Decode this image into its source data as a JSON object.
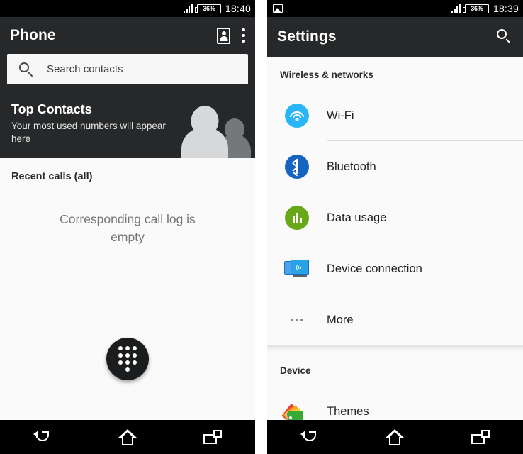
{
  "phone": {
    "statusbar": {
      "signal_icon": "signal-bars-icon",
      "battery_text": "36%",
      "battery_icon": "battery-icon",
      "time": "18:40"
    },
    "appbar": {
      "title": "Phone",
      "contacts_icon": "contacts-card-icon",
      "overflow_icon": "overflow-menu-icon"
    },
    "search": {
      "icon": "search-icon",
      "placeholder": "Search contacts",
      "value": ""
    },
    "top_contacts": {
      "title": "Top Contacts",
      "subtitle": "Your most used numbers will appear here",
      "illustration": "people-silhouette-icon"
    },
    "recent": {
      "label": "Recent calls (all)",
      "empty_message": "Corresponding call log is empty"
    },
    "fab": {
      "icon": "dialpad-icon"
    },
    "navbar": {
      "back": "back-icon",
      "home": "home-icon",
      "recents": "recents-icon"
    }
  },
  "settings": {
    "statusbar": {
      "image_icon": "screenshot-image-icon",
      "signal_icon": "signal-bars-icon",
      "battery_text": "36%",
      "battery_icon": "battery-icon",
      "time": "18:39"
    },
    "appbar": {
      "title": "Settings",
      "search_icon": "search-icon"
    },
    "sections": [
      {
        "heading": "Wireless & networks",
        "items": [
          {
            "label": "Wi-Fi",
            "icon": "wifi-icon",
            "color": "#29b6f6"
          },
          {
            "label": "Bluetooth",
            "icon": "bluetooth-icon",
            "color": "#1565c0"
          },
          {
            "label": "Data usage",
            "icon": "data-usage-icon",
            "color": "#66a816"
          },
          {
            "label": "Device connection",
            "icon": "device-connection-icon",
            "color": "#29a3e8"
          },
          {
            "label": "More",
            "icon": "more-icon",
            "color": "#8a8a8a"
          }
        ]
      },
      {
        "heading": "Device",
        "items": [
          {
            "label": "Themes",
            "icon": "themes-icon",
            "color": "#39a935"
          }
        ]
      }
    ],
    "navbar": {
      "back": "back-icon",
      "home": "home-icon",
      "recents": "recents-icon"
    }
  }
}
